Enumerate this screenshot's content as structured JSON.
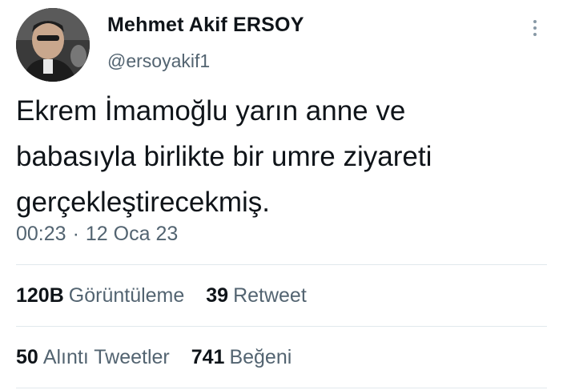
{
  "author": {
    "name": "Mehmet Akif ERSOY",
    "handle": "@ersoyakif1",
    "avatar_icon": "profile-photo"
  },
  "tweet": {
    "lines": [
      "Ekrem İmamoğlu yarın anne ve",
      "babasıyla birlikte bir umre ziyareti",
      "gerçekleştirecekmiş."
    ],
    "time": "00:23",
    "separator": "·",
    "date": "12 Oca 23"
  },
  "stats": {
    "views": {
      "count": "120B",
      "label": "Görüntüleme"
    },
    "retweets": {
      "count": "39",
      "label": "Retweet"
    },
    "quotes": {
      "count": "50",
      "label": "Alıntı Tweetler"
    },
    "likes": {
      "count": "741",
      "label": "Beğeni"
    }
  },
  "menu": {
    "icon": "more-vertical-icon"
  },
  "colors": {
    "text": "#0f1419",
    "secondary": "#536471",
    "divider": "#e1e8ed"
  }
}
